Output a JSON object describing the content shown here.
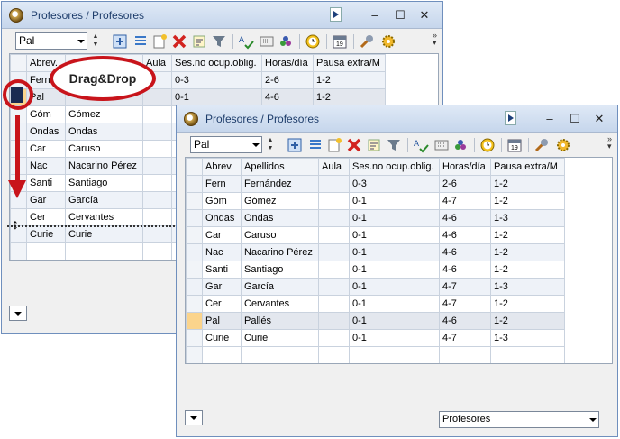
{
  "back_window": {
    "title": "Profesores / Profesores",
    "combo_value": "Pal",
    "columns": [
      "Abrev.",
      "",
      "Aula",
      "Ses.no ocup.oblig.",
      "Horas/día",
      "Pausa extra/M"
    ],
    "rows": [
      [
        "Fern",
        "",
        "",
        "0-3",
        "2-6",
        "1-2"
      ],
      [
        "Pal",
        "",
        "",
        "0-1",
        "4-6",
        "1-2"
      ],
      [
        "Góm",
        "Gómez",
        "",
        "",
        "",
        ""
      ],
      [
        "Ondas",
        "Ondas",
        "",
        "",
        "",
        ""
      ],
      [
        "Car",
        "Caruso",
        "",
        "",
        "",
        ""
      ],
      [
        "Nac",
        "Nacarino Pérez",
        "",
        "",
        "",
        ""
      ],
      [
        "Santi",
        "Santiago",
        "",
        "",
        "",
        ""
      ],
      [
        "Gar",
        "García",
        "",
        "",
        "",
        ""
      ],
      [
        "Cer",
        "Cervantes",
        "",
        "",
        "",
        ""
      ],
      [
        "Curie",
        "Curie",
        "",
        "",
        "",
        ""
      ]
    ]
  },
  "front_window": {
    "title": "Profesores / Profesores",
    "combo_value": "Pal",
    "bottom_select": "Profesores",
    "columns": [
      "Abrev.",
      "Apellidos",
      "Aula",
      "Ses.no ocup.oblig.",
      "Horas/día",
      "Pausa extra/M"
    ],
    "rows": [
      [
        "Fern",
        "Fernández",
        "",
        "0-3",
        "2-6",
        "1-2"
      ],
      [
        "Góm",
        "Gómez",
        "",
        "0-1",
        "4-7",
        "1-2"
      ],
      [
        "Ondas",
        "Ondas",
        "",
        "0-1",
        "4-6",
        "1-3"
      ],
      [
        "Car",
        "Caruso",
        "",
        "0-1",
        "4-6",
        "1-2"
      ],
      [
        "Nac",
        "Nacarino Pérez",
        "",
        "0-1",
        "4-6",
        "1-2"
      ],
      [
        "Santi",
        "Santiago",
        "",
        "0-1",
        "4-6",
        "1-2"
      ],
      [
        "Gar",
        "García",
        "",
        "0-1",
        "4-7",
        "1-3"
      ],
      [
        "Cer",
        "Cervantes",
        "",
        "0-1",
        "4-7",
        "1-2"
      ],
      [
        "Pal",
        "Pallés",
        "",
        "0-1",
        "4-6",
        "1-2"
      ],
      [
        "Curie",
        "Curie",
        "",
        "0-1",
        "4-7",
        "1-3"
      ]
    ],
    "highlighted_row": 8
  },
  "annotation": {
    "bubble_label": "Drag&Drop",
    "accent_color": "#c8141b"
  },
  "window_buttons": {
    "minimize": "–",
    "maximize": "☐",
    "close": "✕"
  },
  "toolbar_icons": [
    "add-row-icon",
    "list-icon",
    "new-item-icon",
    "delete-icon",
    "sort-icon",
    "filter-icon",
    "spellcheck-icon",
    "grid-settings-icon",
    "color-icon",
    "clock-icon",
    "calendar-icon",
    "tools-icon",
    "settings-gear-icon"
  ]
}
